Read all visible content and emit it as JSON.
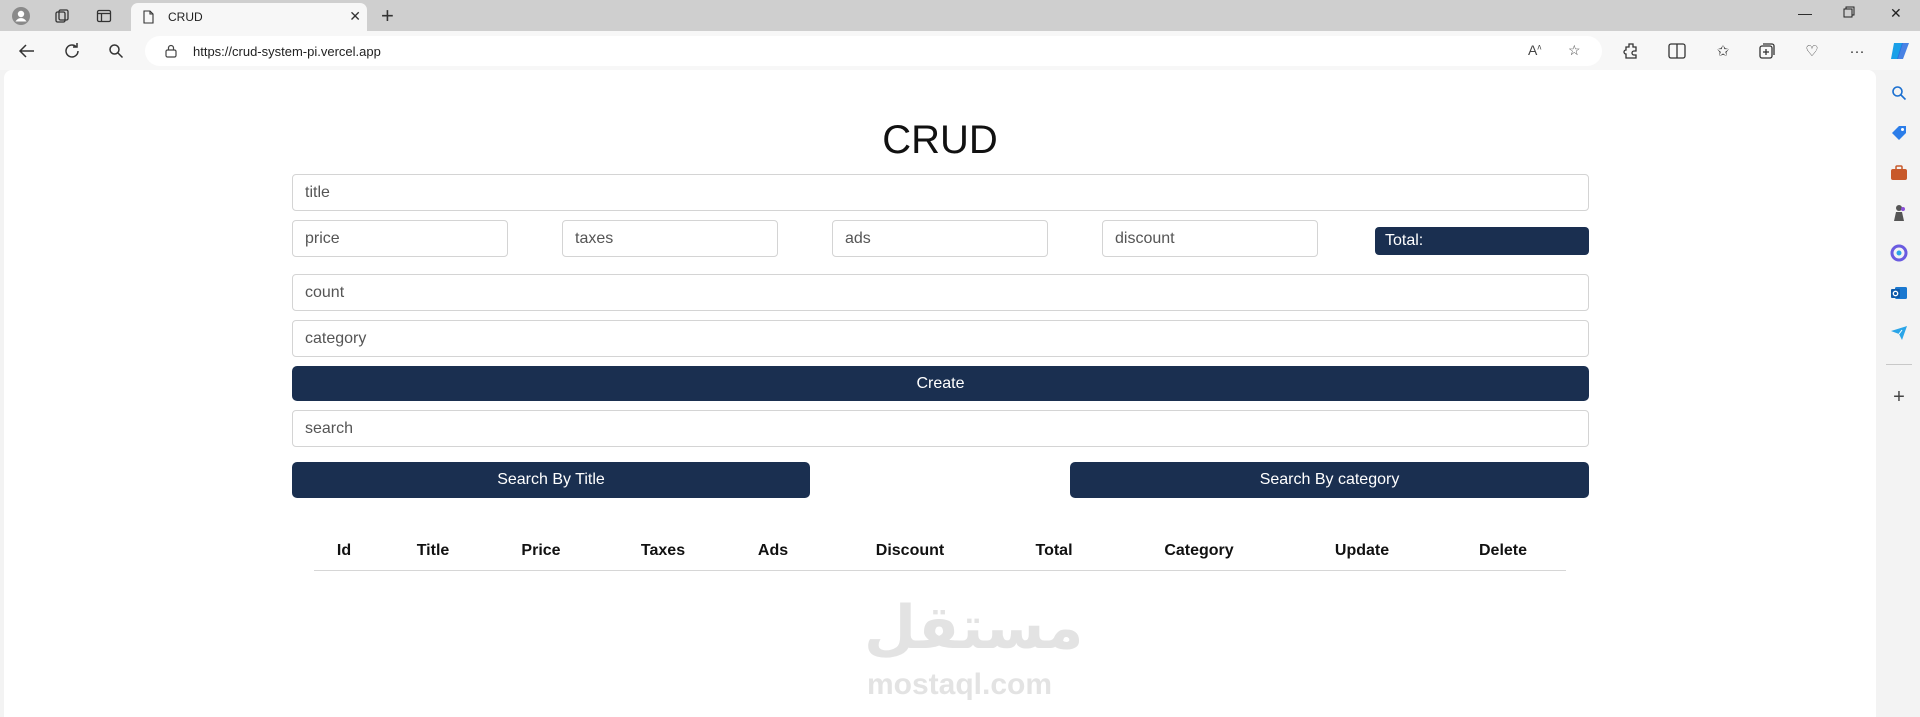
{
  "browser": {
    "tab_title": "CRUD",
    "url": "https://crud-system-pi.vercel.app",
    "icons": {
      "tabbar": [
        "profile-icon",
        "workspaces-icon",
        "tab-actions-icon",
        "page-icon",
        "close-icon",
        "new-tab-icon",
        "minimize-icon",
        "restore-icon",
        "close-window-icon"
      ],
      "toolbar": [
        "back-icon",
        "refresh-icon",
        "search-icon",
        "lock-icon",
        "read-aloud-icon",
        "favorite-star-icon",
        "extensions-icon",
        "split-screen-icon",
        "favorites-icon",
        "collections-icon",
        "browser-essentials-icon",
        "more-icon",
        "copilot-icon"
      ],
      "sidebar": [
        "search-icon",
        "shopping-tag-icon",
        "tools-icon",
        "games-icon",
        "microsoft-365-icon",
        "outlook-icon",
        "drop-icon",
        "add-icon"
      ]
    }
  },
  "page": {
    "title": "CRUD",
    "form": {
      "title_placeholder": "title",
      "price_placeholder": "price",
      "taxes_placeholder": "taxes",
      "ads_placeholder": "ads",
      "discount_placeholder": "discount",
      "total_label": "Total:",
      "count_placeholder": "count",
      "category_placeholder": "category",
      "create_label": "Create"
    },
    "search": {
      "placeholder": "search",
      "by_title_label": "Search By Title",
      "by_category_label": "Search By category"
    },
    "table": {
      "headers": [
        "Id",
        "Title",
        "Price",
        "Taxes",
        "Ads",
        "Discount",
        "Total",
        "Category",
        "Update",
        "Delete"
      ],
      "rows": []
    },
    "watermark": {
      "arabic": "مستقل",
      "latin": "mostaql.com"
    }
  },
  "colors": {
    "primary_button": "#1a2f50",
    "page_background": "#ffffff",
    "chrome_background": "#cfcfcf"
  }
}
